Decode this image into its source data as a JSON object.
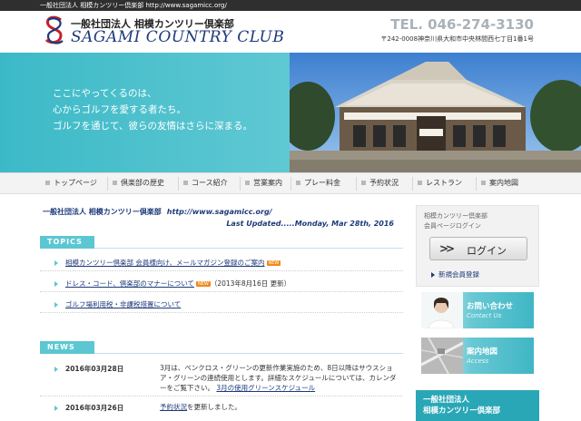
{
  "top_strip": "一般社団法人 相模カンツリー倶楽部  http://www.sagamicc.org/",
  "header": {
    "org_jp": "一般社団法人 相模カンツリー倶楽部",
    "org_en": "SAGAMI COUNTRY CLUB",
    "tel": "TEL. 046-274-3130",
    "address": "〒242-0008神奈川県大和市中央林間西七丁目1番1号"
  },
  "hero": {
    "lines": [
      "ここにやってくるのは、",
      "心からゴルフを愛する者たち。",
      "ゴルフを通じて、彼らの友情はさらに深まる。"
    ]
  },
  "nav": {
    "items": [
      "トップページ",
      "倶楽部の歴史",
      "コース紹介",
      "営業案内",
      "プレー料金",
      "予約状況",
      "レストラン",
      "案内地図"
    ]
  },
  "main": {
    "org_name": "一般社団法人 相模カンツリー倶楽部",
    "url": "http://www.sagamicc.org/",
    "last_updated": "Last Updated.....Monday, Mar 28th, 2016",
    "topics_label": "TOPICS",
    "topics": [
      {
        "link": "相模カンツリー倶楽部 会員様向け、メールマガジン登録のご案内",
        "suffix": "",
        "badge": "NEW"
      },
      {
        "link": "ドレス・コード、倶楽部のマナーについて",
        "suffix": "（2013年8月16日 更新）",
        "badge": "NEW"
      },
      {
        "link": "ゴルフ場利用税・非課税措置について",
        "suffix": "",
        "badge": ""
      }
    ],
    "news_label": "NEWS",
    "news": [
      {
        "date": "2016年03月28日",
        "text": "3月は、ベンクロス・グリーンの更新作業実施のため、8日以降はサウスショア・グリーンの連続使用とします。詳細なスケジュールについては、カレンダーをご覧下さい。",
        "link": "3月の使用グリーンスケジュール",
        "link_prefix": "",
        "after": ""
      },
      {
        "date": "2016年03月26日",
        "text": "",
        "link": "予約状況",
        "link_prefix": "",
        "after": "を更新しました。"
      }
    ]
  },
  "sidebar": {
    "login_title_1": "相模カンツリー倶楽部",
    "login_title_2": "会員ページログイン",
    "login_button": "ログイン",
    "register_link": "新規会員登録",
    "contact_title": "お問い合わせ",
    "contact_sub": "Contact Us",
    "map_title": "案内地図",
    "map_sub": "Access",
    "org_line1": "一般社団法人",
    "org_line2": "相模カンツリー倶楽部"
  },
  "colors": {
    "accent": "#5cc7d2",
    "navy": "#1d3a7a",
    "badge": "#f08a1c",
    "org_box": "#2aa7b7"
  }
}
